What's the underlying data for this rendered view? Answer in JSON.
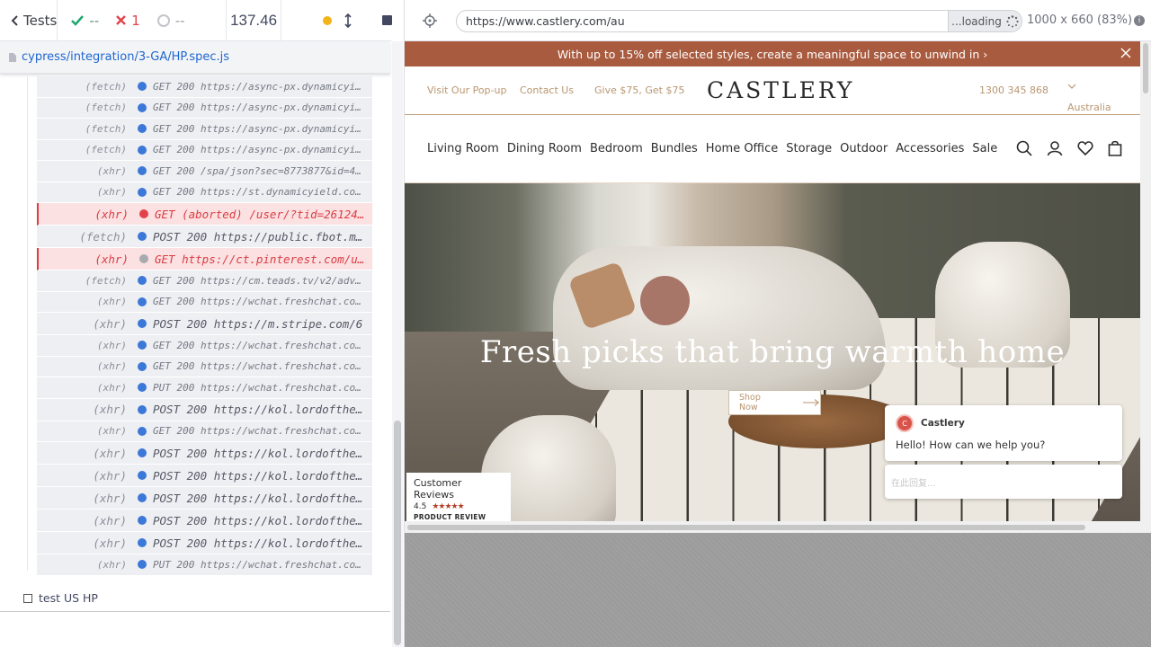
{
  "runner": {
    "back_label": "Tests",
    "passed": "--",
    "failed": "1",
    "pending": "--",
    "duration": "137.46",
    "spec_path": "cypress/integration/3-GA/HP.spec.js",
    "second_test": "test US HP"
  },
  "commands": [
    {
      "kind": "(fetch)",
      "text": "GET 200 https://async-px.dynamicyield...",
      "style": "normal",
      "dot": "blue"
    },
    {
      "kind": "(fetch)",
      "text": "GET 200 https://async-px.dynamicyield...",
      "style": "normal",
      "dot": "blue"
    },
    {
      "kind": "(fetch)",
      "text": "GET 200 https://async-px.dynamicyield...",
      "style": "normal",
      "dot": "blue"
    },
    {
      "kind": "(fetch)",
      "text": "GET 200 https://async-px.dynamicyield...",
      "style": "normal",
      "dot": "blue"
    },
    {
      "kind": "(xhr)",
      "text": "GET 200 /spa/json?sec=8773877&id=45936...",
      "style": "normal",
      "dot": "blue"
    },
    {
      "kind": "(xhr)",
      "text": "GET 200 https://st.dynamicyield.com/sp...",
      "style": "normal",
      "dot": "blue"
    },
    {
      "kind": "(xhr)",
      "text": "GET (aborted) /user/?tid=261244...",
      "style": "err",
      "dot": "red"
    },
    {
      "kind": "(fetch)",
      "text": "POST 200 https://public.fbot.me...",
      "style": "big",
      "dot": "blue"
    },
    {
      "kind": "(xhr)",
      "text": "GET https://ct.pinterest.com/us...",
      "style": "err",
      "dot": "grey"
    },
    {
      "kind": "(fetch)",
      "text": "GET 200 https://cm.teads.tv/v2/adverti...",
      "style": "normal",
      "dot": "blue"
    },
    {
      "kind": "(xhr)",
      "text": "GET 200 https://wchat.freshchat.com/ap...",
      "style": "normal",
      "dot": "blue"
    },
    {
      "kind": "(xhr)",
      "text": "POST 200 https://m.stripe.com/6",
      "style": "big",
      "dot": "blue"
    },
    {
      "kind": "(xhr)",
      "text": "GET 200 https://wchat.freshchat.com/ap...",
      "style": "normal",
      "dot": "blue"
    },
    {
      "kind": "(xhr)",
      "text": "GET 200 https://wchat.freshchat.com/ap...",
      "style": "normal",
      "dot": "blue"
    },
    {
      "kind": "(xhr)",
      "text": "PUT 200 https://wchat.freshchat.com/ap...",
      "style": "normal",
      "dot": "blue"
    },
    {
      "kind": "(xhr)",
      "text": "POST 200 https://kol.lordofthee...",
      "style": "big",
      "dot": "blue"
    },
    {
      "kind": "(xhr)",
      "text": "GET 200 https://wchat.freshchat.com/ap...",
      "style": "normal",
      "dot": "blue"
    },
    {
      "kind": "(xhr)",
      "text": "POST 200 https://kol.lordofthee...",
      "style": "big",
      "dot": "blue"
    },
    {
      "kind": "(xhr)",
      "text": "POST 200 https://kol.lordofthee...",
      "style": "big",
      "dot": "blue"
    },
    {
      "kind": "(xhr)",
      "text": "POST 200 https://kol.lordofthee...",
      "style": "big",
      "dot": "blue"
    },
    {
      "kind": "(xhr)",
      "text": "POST 200 https://kol.lordofthee...",
      "style": "big",
      "dot": "blue"
    },
    {
      "kind": "(xhr)",
      "text": "POST 200 https://kol.lordofthee...",
      "style": "big",
      "dot": "blue"
    },
    {
      "kind": "(xhr)",
      "text": "PUT 200 https://wchat.freshchat.com/ap...",
      "style": "normal",
      "dot": "blue"
    }
  ],
  "browser": {
    "url": "https://www.castlery.com/au",
    "loading": "...loading",
    "viewport": "1000 x 660",
    "scale": "(83%)"
  },
  "site": {
    "promo": "With up to 15% off selected styles, create a meaningful space to unwind in ›",
    "header_links": [
      "Visit Our Pop-up",
      "Contact Us",
      "Give $75, Get $75"
    ],
    "logo": "CASTLERY",
    "phone": "1300 345 868",
    "country": "Australia",
    "nav": [
      "Living Room",
      "Dining Room",
      "Bedroom",
      "Bundles",
      "Home Office",
      "Storage",
      "Outdoor",
      "Accessories",
      "Sale"
    ],
    "hero_title": "Fresh picks that bring warmth home",
    "hero_button": "Shop Now",
    "reviews_title": "Customer Reviews",
    "reviews_score": "4.5",
    "reviews_brand": "PRODUCT REVIEW",
    "chat_name": "Castlery",
    "chat_avatar": "C",
    "chat_message": "Hello! How can we help you?",
    "chat_placeholder": "在此回复..."
  },
  "colors": {
    "promo": "#a95b3f",
    "accent": "#b99670",
    "fail": "#e2434b",
    "pass": "#1fa971"
  }
}
